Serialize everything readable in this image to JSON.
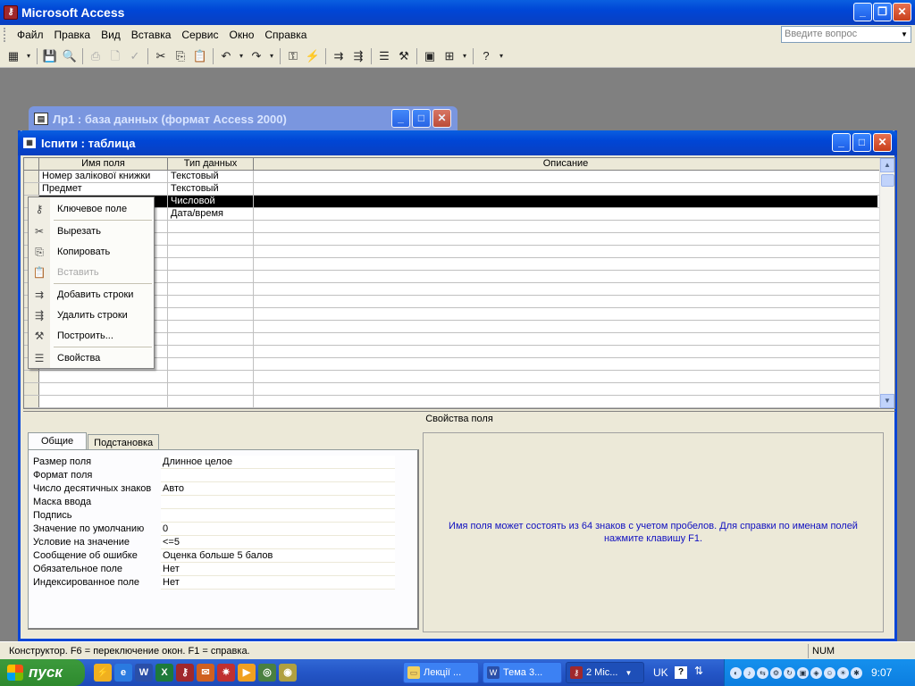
{
  "app": {
    "title": "Microsoft Access"
  },
  "menu": {
    "items": [
      "Файл",
      "Правка",
      "Вид",
      "Вставка",
      "Сервис",
      "Окно",
      "Справка"
    ],
    "ask_placeholder": "Введите вопрос"
  },
  "toolbar": {
    "icons": [
      "view-icon",
      "save-icon",
      "search-icon",
      "print-icon",
      "print-preview-icon",
      "spelling-icon",
      "cut-icon",
      "copy-icon",
      "paste-icon",
      "undo-icon",
      "redo-icon",
      "primary-key-icon",
      "indexes-icon",
      "insert-rows-icon",
      "delete-rows-icon",
      "properties-icon",
      "build-icon",
      "database-window-icon",
      "new-object-icon",
      "help-icon"
    ]
  },
  "db_window": {
    "title": "Лр1 : база данных (формат Access 2000)"
  },
  "table_window": {
    "title": "Іспити : таблица",
    "columns": [
      "Имя поля",
      "Тип данных",
      "Описание"
    ],
    "rows": [
      {
        "name": "Номер залікової книжки",
        "type": "Текстовый",
        "desc": "",
        "selected": false
      },
      {
        "name": "Предмет",
        "type": "Текстовый",
        "desc": "",
        "selected": false
      },
      {
        "name": "",
        "type": "Числовой",
        "desc": "",
        "selected": true
      },
      {
        "name": "",
        "type": "Дата/время",
        "desc": "",
        "selected": false
      }
    ],
    "empty_rows": 15,
    "properties_label": "Свойства поля",
    "tabs": [
      "Общие",
      "Подстановка"
    ],
    "properties": [
      {
        "label": "Размер поля",
        "value": "Длинное целое"
      },
      {
        "label": "Формат поля",
        "value": ""
      },
      {
        "label": "Число десятичных знаков",
        "value": "Авто"
      },
      {
        "label": "Маска ввода",
        "value": ""
      },
      {
        "label": "Подпись",
        "value": ""
      },
      {
        "label": "Значение по умолчанию",
        "value": "0"
      },
      {
        "label": "Условие на значение",
        "value": "<=5"
      },
      {
        "label": "Сообщение об ошибке",
        "value": "Оценка больше 5 балов"
      },
      {
        "label": "Обязательное поле",
        "value": "Нет"
      },
      {
        "label": "Индексированное поле",
        "value": "Нет"
      }
    ],
    "hint": "Имя поля может состоять из 64 знаков с учетом пробелов.  Для справки по именам полей нажмите клавишу F1."
  },
  "context_menu": {
    "items": [
      {
        "label": "Ключевое поле",
        "icon": "key-icon",
        "disabled": false
      },
      {
        "label": "Вырезать",
        "icon": "scissors-icon",
        "disabled": false
      },
      {
        "label": "Копировать",
        "icon": "copy-icon",
        "disabled": false
      },
      {
        "label": "Вставить",
        "icon": "paste-icon",
        "disabled": true
      },
      {
        "label": "Добавить строки",
        "icon": "insert-rows-icon",
        "disabled": false
      },
      {
        "label": "Удалить строки",
        "icon": "delete-rows-icon",
        "disabled": false
      },
      {
        "label": "Построить...",
        "icon": "build-icon",
        "disabled": false
      },
      {
        "label": "Свойства",
        "icon": "properties-icon",
        "disabled": false
      }
    ]
  },
  "status": {
    "text": "Конструктор.  F6 = переключение окон.  F1 = справка.",
    "num": "NUM"
  },
  "taskbar": {
    "start_label": "пуск",
    "buttons": [
      {
        "label": "Лекції ...",
        "icon": "folder-icon",
        "active": false
      },
      {
        "label": "Тема 3...",
        "icon": "word-icon",
        "active": false
      },
      {
        "label": "2 Mic...",
        "icon": "access-icon",
        "active": true
      }
    ],
    "lang": "UK",
    "clock": "9:07"
  },
  "colors": {
    "titlebar": "#0a46d6",
    "face": "#ece9d8",
    "hint_text": "#1010c0",
    "workspace": "#808080"
  }
}
